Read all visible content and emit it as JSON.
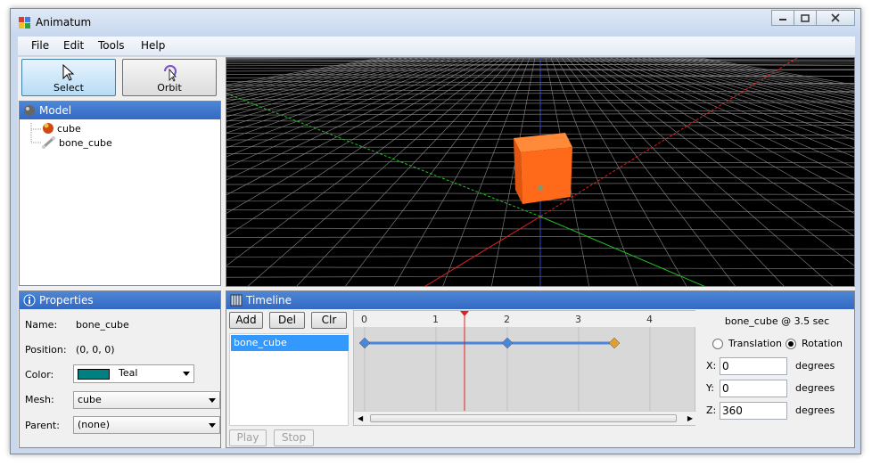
{
  "window": {
    "title": "Animatum"
  },
  "menu": [
    "File",
    "Edit",
    "Tools",
    "Help"
  ],
  "tools": {
    "select": "Select",
    "orbit": "Orbit"
  },
  "model_panel": {
    "title": "Model",
    "items": [
      "cube",
      "bone_cube"
    ]
  },
  "properties": {
    "title": "Properties",
    "name_label": "Name:",
    "name_value": "bone_cube",
    "position_label": "Position:",
    "position_value": "(0, 0, 0)",
    "color_label": "Color:",
    "color_value": "Teal",
    "color_swatch": "#008080",
    "mesh_label": "Mesh:",
    "mesh_value": "cube",
    "parent_label": "Parent:",
    "parent_value": "(none)"
  },
  "timeline": {
    "title": "Timeline",
    "add": "Add",
    "del": "Del",
    "clr": "Clr",
    "play": "Play",
    "stop": "Stop",
    "ticks": [
      "0",
      "1",
      "2",
      "3",
      "4"
    ],
    "tracks": [
      "bone_cube"
    ],
    "playhead_time": 1.4,
    "keyframes": [
      0,
      2,
      3.5
    ]
  },
  "keyframe": {
    "header": "bone_cube @ 3.5 sec",
    "translation": "Translation",
    "rotation": "Rotation",
    "mode": "rotation",
    "x_label": "X:",
    "x_value": "0",
    "y_label": "Y:",
    "y_value": "0",
    "z_label": "Z:",
    "z_value": "360",
    "unit": "degrees"
  },
  "colors": {
    "accent": "#3369c3",
    "cube": "#ff6a1a",
    "keyframe": "#4a86d8",
    "keyframe_selected": "#e0a030",
    "playhead": "#e02020"
  }
}
